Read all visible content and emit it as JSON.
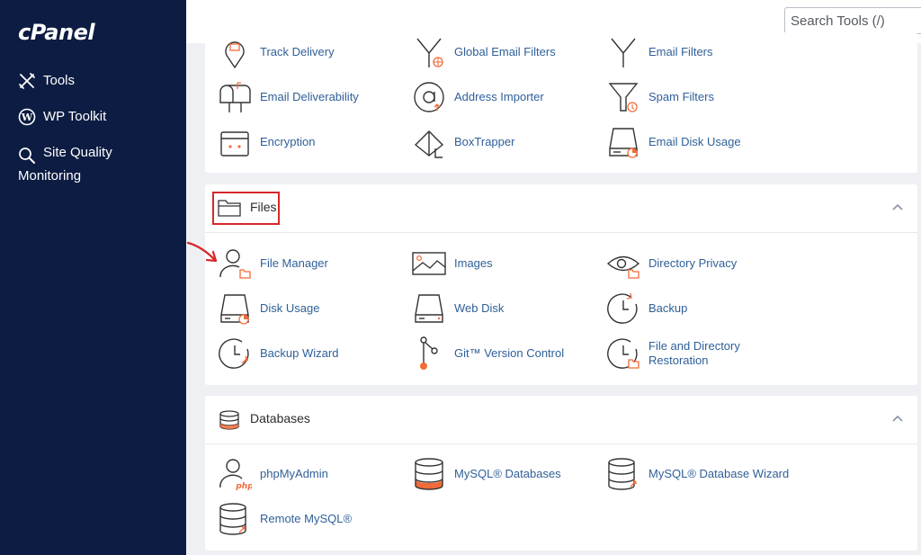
{
  "sidebar": {
    "logo": "cPanel",
    "items": [
      {
        "label": "Tools",
        "icon": "tools-icon"
      },
      {
        "label": "WP Toolkit",
        "icon": "wordpress-icon"
      },
      {
        "label": "Site Quality Monitoring",
        "icon": "search-magnifier-icon"
      }
    ]
  },
  "search": {
    "placeholder": "Search Tools (/)"
  },
  "email_section": {
    "tools": [
      {
        "label": "Track Delivery",
        "icon": "track-delivery-icon"
      },
      {
        "label": "Global Email Filters",
        "icon": "global-filter-icon"
      },
      {
        "label": "Email Filters",
        "icon": "email-filter-icon"
      },
      {
        "label": "Email Deliverability",
        "icon": "mailbox-icon"
      },
      {
        "label": "Address Importer",
        "icon": "address-importer-icon"
      },
      {
        "label": "Spam Filters",
        "icon": "spam-filter-icon"
      },
      {
        "label": "Encryption",
        "icon": "encryption-icon"
      },
      {
        "label": "BoxTrapper",
        "icon": "boxtrapper-icon"
      },
      {
        "label": "Email Disk Usage",
        "icon": "email-disk-usage-icon"
      }
    ]
  },
  "files_section": {
    "title": "Files",
    "tools": [
      {
        "label": "File Manager",
        "icon": "file-manager-icon"
      },
      {
        "label": "Images",
        "icon": "images-icon"
      },
      {
        "label": "Directory Privacy",
        "icon": "directory-privacy-icon"
      },
      {
        "label": "Disk Usage",
        "icon": "disk-usage-icon"
      },
      {
        "label": "Web Disk",
        "icon": "web-disk-icon"
      },
      {
        "label": "Backup",
        "icon": "backup-icon"
      },
      {
        "label": "Backup Wizard",
        "icon": "backup-wizard-icon"
      },
      {
        "label": "Git™ Version Control",
        "icon": "git-icon"
      },
      {
        "label": "File and Directory Restoration",
        "icon": "restoration-icon"
      }
    ]
  },
  "databases_section": {
    "title": "Databases",
    "tools": [
      {
        "label": "phpMyAdmin",
        "icon": "phpmyadmin-icon"
      },
      {
        "label": "MySQL® Databases",
        "icon": "mysql-databases-icon"
      },
      {
        "label": "MySQL® Database Wizard",
        "icon": "mysql-wizard-icon"
      },
      {
        "label": "Remote MySQL®",
        "icon": "remote-mysql-icon"
      }
    ]
  },
  "colors": {
    "sidebar": "#0d1c42",
    "link": "#2f5f98",
    "accent": "#f26b38",
    "highlight": "#d9262b"
  }
}
